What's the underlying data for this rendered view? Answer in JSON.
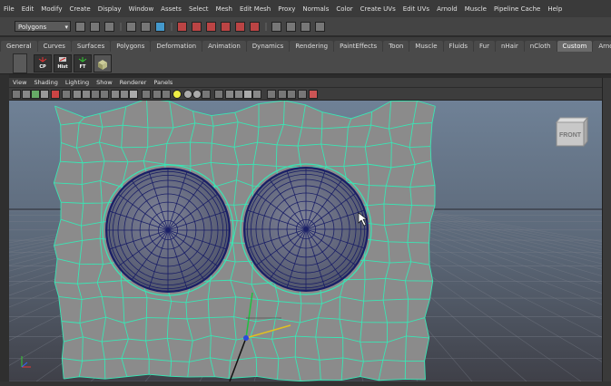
{
  "main_menu": [
    "File",
    "Edit",
    "Modify",
    "Create",
    "Display",
    "Window",
    "Assets",
    "Select",
    "Mesh",
    "Edit Mesh",
    "Proxy",
    "Normals",
    "Color",
    "Create UVs",
    "Edit UVs",
    "Arnold",
    "Muscle",
    "Pipeline Cache",
    "Help"
  ],
  "mode_selector": "Polygons",
  "shelf_tabs": [
    "General",
    "Curves",
    "Surfaces",
    "Polygons",
    "Deformation",
    "Animation",
    "Dynamics",
    "Rendering",
    "PaintEffects",
    "Toon",
    "Muscle",
    "Fluids",
    "Fur",
    "nHair",
    "nCloth",
    "Custom",
    "Arnold"
  ],
  "active_shelf_tab": "Custom",
  "shelf_buttons": [
    {
      "label": "CP",
      "icon": "axis-icon"
    },
    {
      "label": "Hist",
      "icon": "history-icon"
    },
    {
      "label": "FT",
      "icon": "axis-icon"
    },
    {
      "label": "",
      "icon": "cube-icon"
    }
  ],
  "panel_menu": [
    "View",
    "Shading",
    "Lighting",
    "Show",
    "Renderer",
    "Panels"
  ],
  "view_cube_label": "FRONT",
  "colors": {
    "wire": "#39e6b4",
    "sphere_wire": "#1a1f66",
    "mesh": "#8b8b8b",
    "sky_top": "#6f8196",
    "sky_bottom": "#3f4048"
  }
}
